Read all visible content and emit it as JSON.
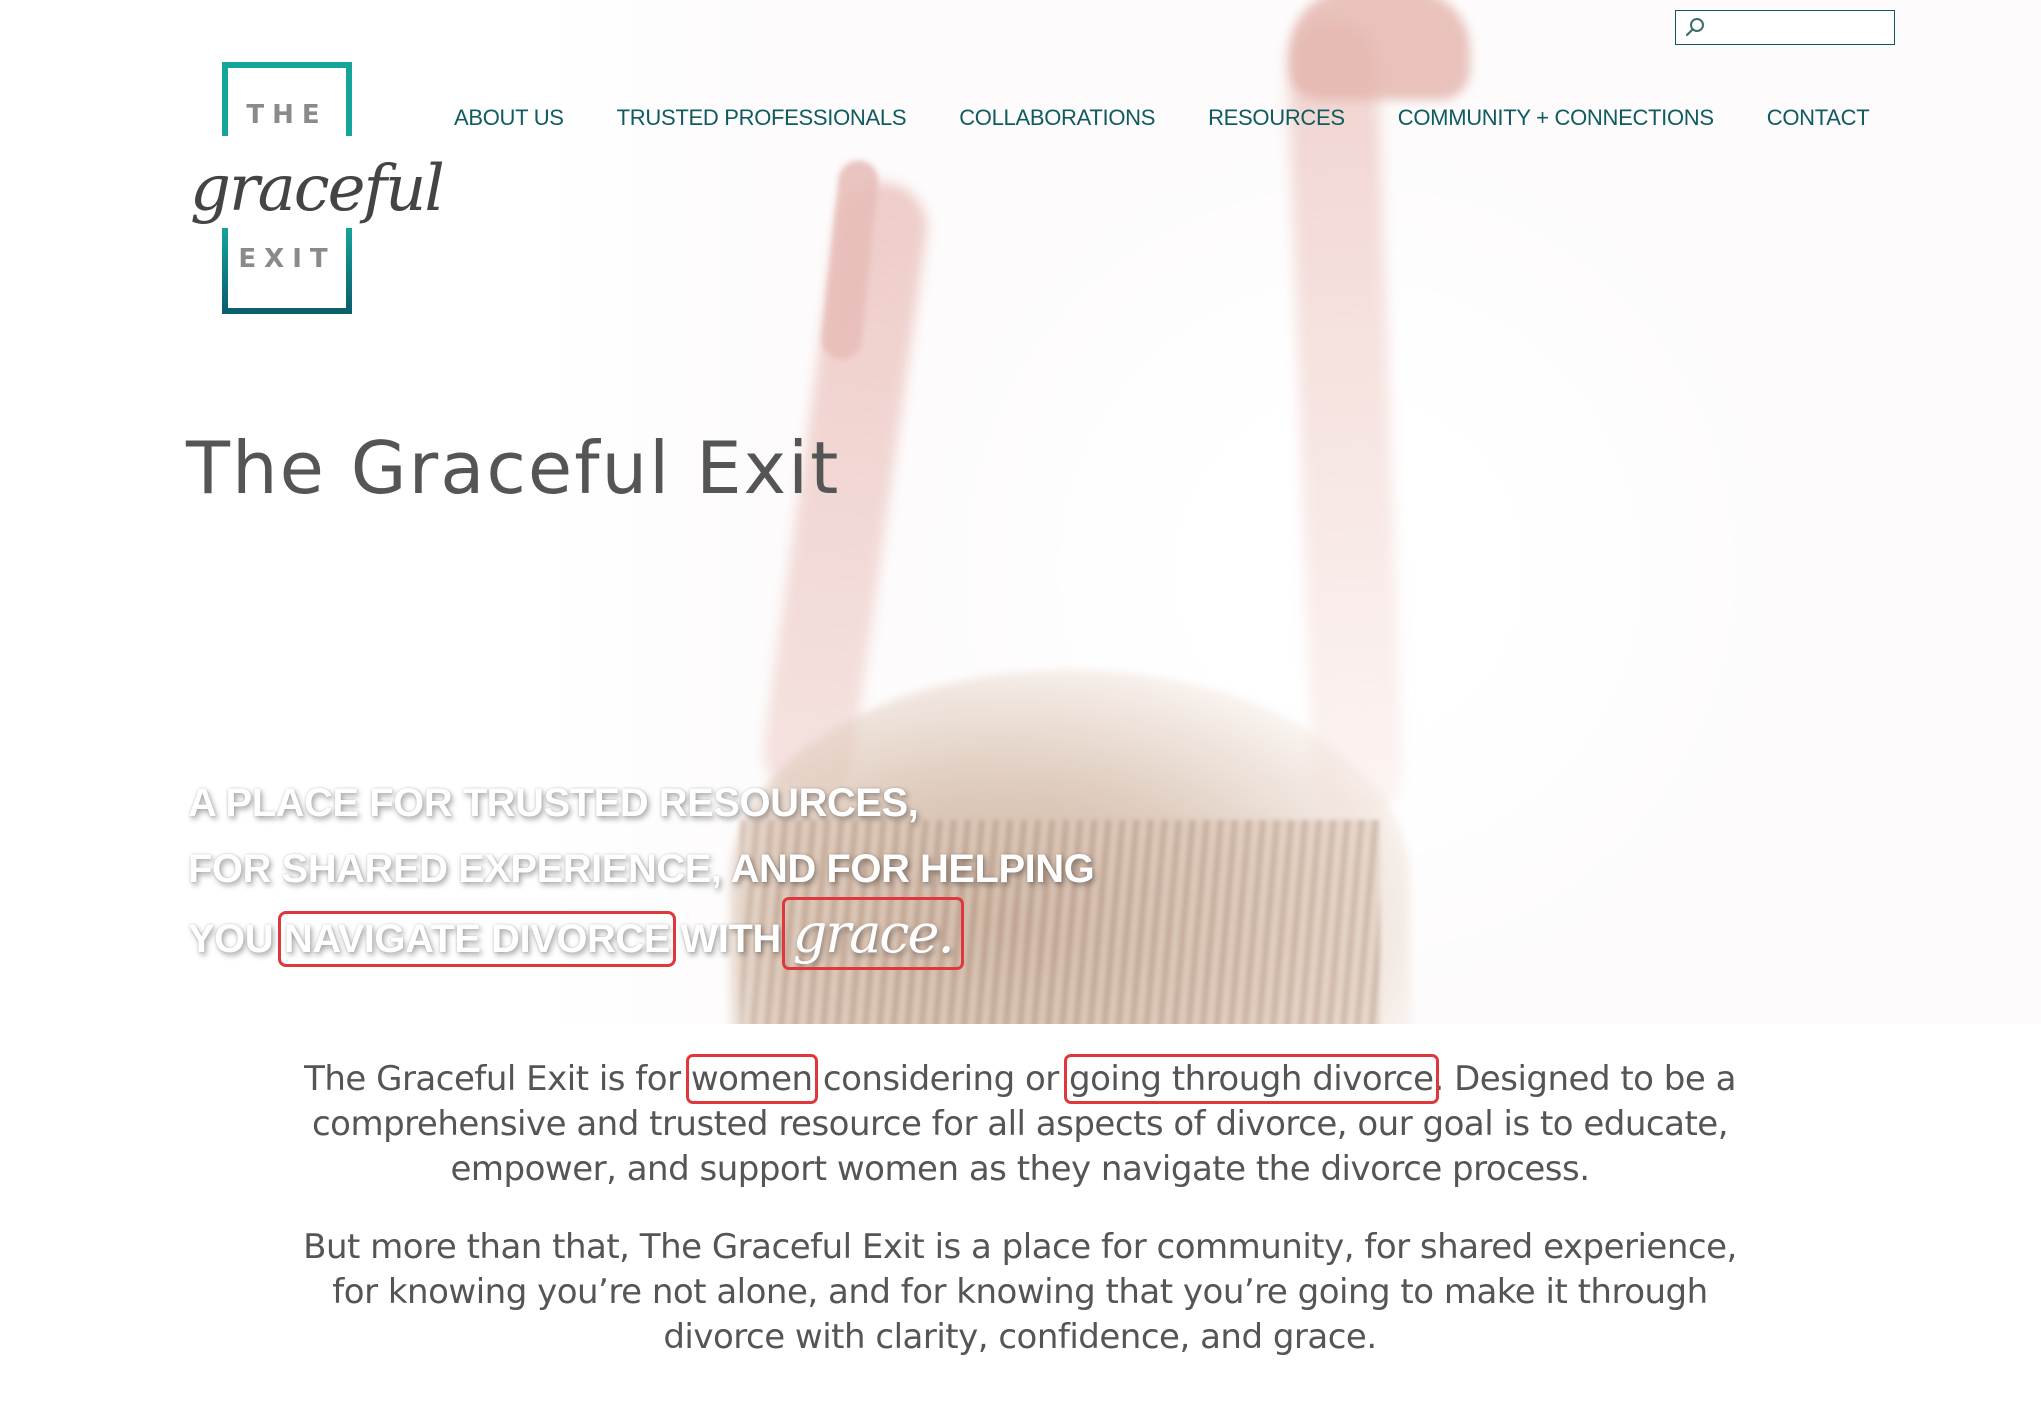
{
  "site": {
    "logo": {
      "top": "THE",
      "middle": "graceful",
      "bottom": "EXIT"
    },
    "colors": {
      "brand_teal": "#14a49a",
      "brand_dark_teal": "#0f5b5f",
      "text_gray": "#555555",
      "highlight_red": "#e0373c"
    }
  },
  "nav": {
    "items": [
      {
        "label": "ABOUT US"
      },
      {
        "label": "TRUSTED PROFESSIONALS"
      },
      {
        "label": "COLLABORATIONS"
      },
      {
        "label": "RESOURCES"
      },
      {
        "label": "COMMUNITY + CONNECTIONS"
      },
      {
        "label": "CONTACT"
      }
    ]
  },
  "search": {
    "icon": "search-icon",
    "value": "",
    "placeholder": ""
  },
  "hero": {
    "title": "The Graceful Exit",
    "tagline": {
      "line1": "A PLACE FOR TRUSTED RESOURCES,",
      "line2": "FOR SHARED EXPERIENCE, AND FOR HELPING",
      "line3_pre": "YOU",
      "line3_highlight": "NAVIGATE DIVORCE",
      "line3_mid": "WITH",
      "line3_script": "grace."
    }
  },
  "intro": {
    "p1": {
      "pre": "The Graceful Exit is for ",
      "highlight1": "women",
      "mid": " considering or ",
      "highlight2": "going through divorce",
      "post": ". Designed to be a comprehensive and trusted resource for all aspects of divorce, our goal is to educate, empower, and support women as they navigate the divorce process."
    },
    "p2": "But more than that, The Graceful Exit is a place for community, for shared experience, for knowing you’re not alone, and for knowing that you’re going to make it through divorce with clarity, confidence, and grace."
  }
}
